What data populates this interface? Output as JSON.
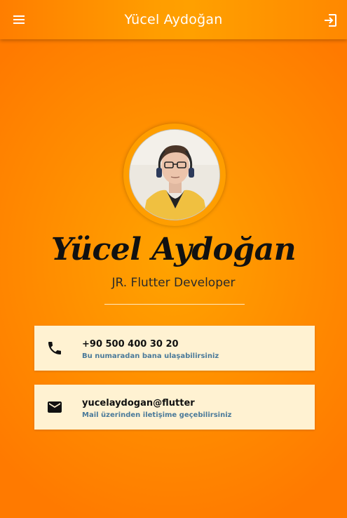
{
  "appbar": {
    "title": "Yücel Aydoğan",
    "menu_icon": "menu-icon",
    "login_icon": "login-icon"
  },
  "profile": {
    "name": "Yücel Aydoğan",
    "role": "JR. Flutter Developer",
    "avatar": "profile-photo"
  },
  "contacts": [
    {
      "icon": "phone-icon",
      "primary": "+90 500 400 30 20",
      "secondary": "Bu numaradan bana ulaşabilirsiniz"
    },
    {
      "icon": "mail-icon",
      "primary": "yucelaydogan@flutter",
      "secondary": "Mail üzerinden iletişime geçebilirsiniz"
    }
  ],
  "colors": {
    "background": "#ff8c00",
    "card": "#fff2d2",
    "secondary_text": "#4a7a9a"
  }
}
